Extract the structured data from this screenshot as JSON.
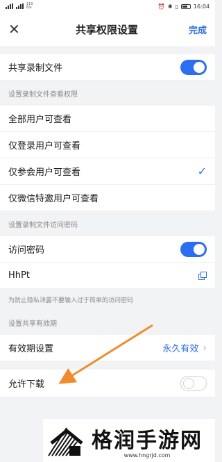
{
  "status_bar": {
    "net_speed_value": "110",
    "net_speed_unit": "B/s",
    "time": "16:04"
  },
  "nav": {
    "close_icon": "close-icon",
    "title": "共享权限设置",
    "done_label": "完成"
  },
  "share_recording": {
    "label": "共享录制文件",
    "enabled": true
  },
  "view_permission": {
    "section_label": "设置录制文件查看权限",
    "options": [
      {
        "label": "全部用户可查看",
        "selected": false
      },
      {
        "label": "仅登录用户可查看",
        "selected": false
      },
      {
        "label": "仅参会用户可查看",
        "selected": true
      },
      {
        "label": "仅微信特邀用户可查看",
        "selected": false
      }
    ]
  },
  "access_password": {
    "section_label": "设置录制文件访问密码",
    "toggle_label": "访问密码",
    "enabled": true,
    "password_value": "HhPt",
    "hint": "为防止隐私泄露不要输入过于简单的访问密码"
  },
  "validity": {
    "section_label": "设置共享有效期",
    "row_label": "有效期设置",
    "row_value": "永久有效"
  },
  "download": {
    "label": "允许下载",
    "enabled": false
  },
  "watermark": {
    "brand": "格润手游网",
    "url": "www.hngrjd.com"
  },
  "colors": {
    "accent": "#2f6fe4",
    "toggle_on": "#2c6ef0",
    "arrow": "#f08c2e"
  }
}
